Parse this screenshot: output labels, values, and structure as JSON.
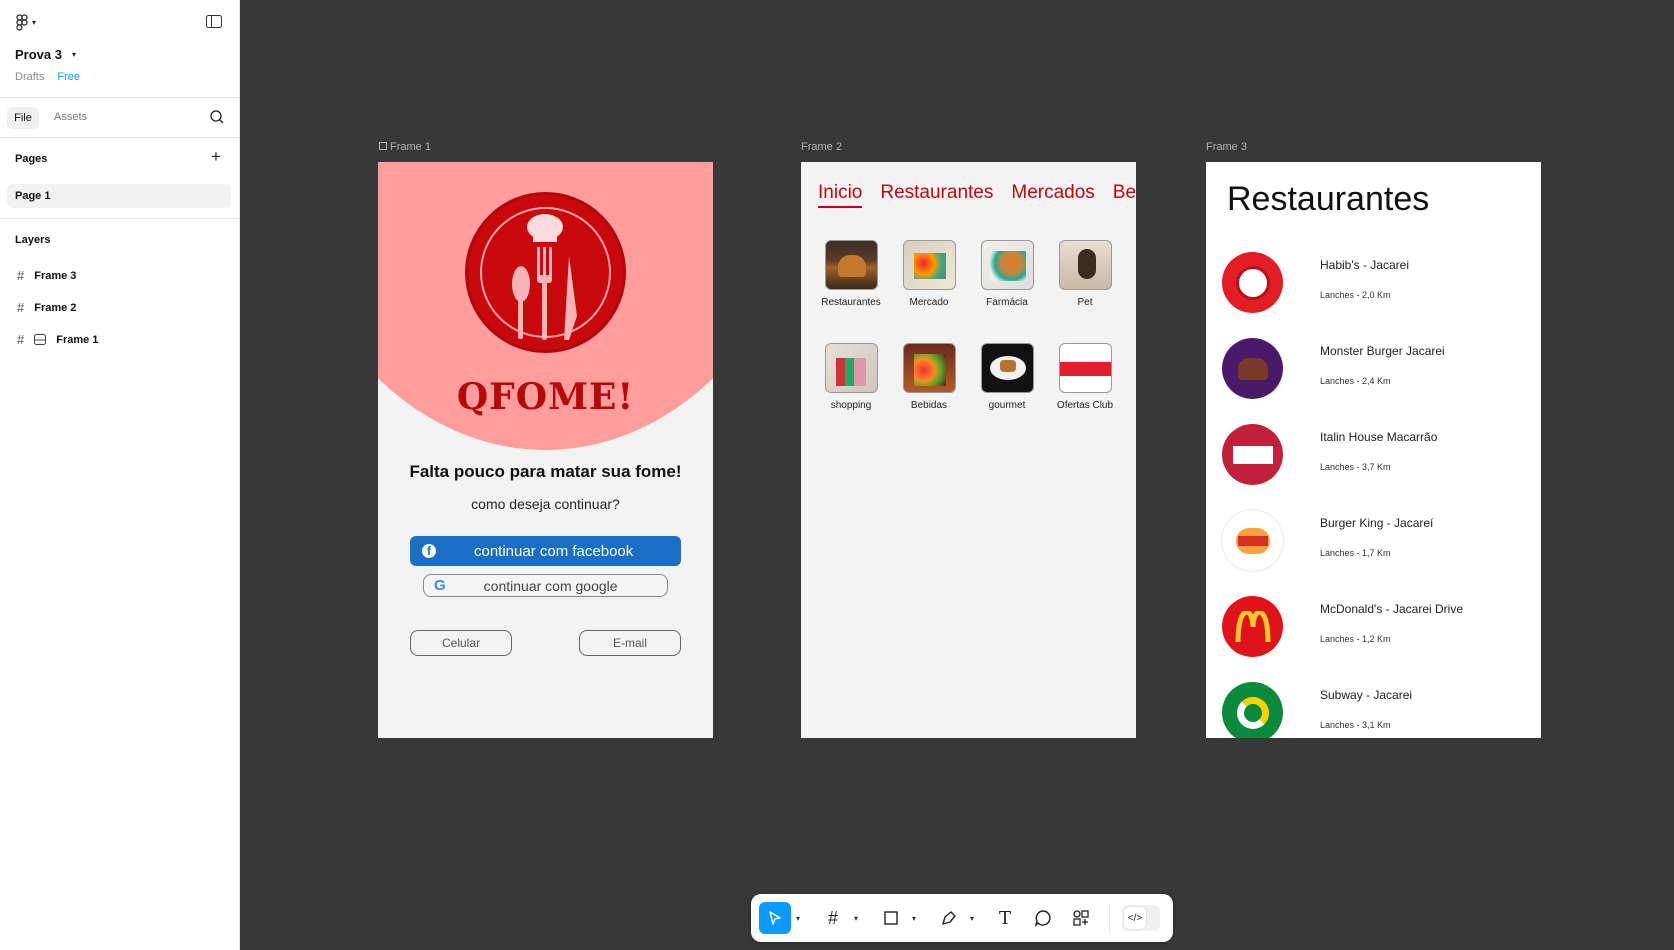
{
  "sidebar": {
    "project_name": "Prova 3",
    "location": "Drafts",
    "plan_badge": "Free",
    "tabs": {
      "file": "File",
      "assets": "Assets"
    },
    "pages_heading": "Pages",
    "pages": [
      {
        "label": "Page 1"
      }
    ],
    "layers_heading": "Layers",
    "layers": [
      {
        "label": "Frame 3"
      },
      {
        "label": "Frame 2"
      },
      {
        "label": "Frame 1"
      }
    ]
  },
  "canvas": {
    "frame_labels": [
      "Frame 1",
      "Frame 2",
      "Frame 3"
    ],
    "frame1": {
      "brand": "QFOME!",
      "tagline": "Falta pouco para matar sua fome!",
      "subtitle": "como deseja continuar?",
      "facebook_button": "continuar com facebook",
      "google_button": "continuar com google",
      "phone_button": "Celular",
      "email_button": "E-mail"
    },
    "frame2": {
      "tabs": [
        "Inicio",
        "Restaurantes",
        "Mercados",
        "Bebidas"
      ],
      "categories": [
        {
          "label": "Restaurantes"
        },
        {
          "label": "Mercado"
        },
        {
          "label": "Farmácia"
        },
        {
          "label": "Pet"
        },
        {
          "label": "shopping"
        },
        {
          "label": "Bebidas"
        },
        {
          "label": "gourmet"
        },
        {
          "label": "Ofertas Club"
        }
      ]
    },
    "frame3": {
      "title": "Restaurantes",
      "restaurants": [
        {
          "name": "Habib's - Jacarei",
          "meta": "Lanches - 2,0 Km"
        },
        {
          "name": "Monster Burger Jacarei",
          "meta": "Lanches - 2,4 Km"
        },
        {
          "name": "Italin House Macarrão",
          "meta": "Lanches - 3,7 Km"
        },
        {
          "name": "Burger King - Jacareí",
          "meta": "Lanches - 1,7 Km"
        },
        {
          "name": "McDonald's - Jacarei Drive",
          "meta": "Lanches - 1,2 Km"
        },
        {
          "name": "Subway - Jacarei",
          "meta": "Lanches - 3,1 Km"
        }
      ]
    }
  },
  "colors": {
    "accent": "#0d99ff",
    "brand_red": "#c0080c",
    "facebook_blue": "#1a6fc4",
    "pink": "#ff9c9c"
  }
}
